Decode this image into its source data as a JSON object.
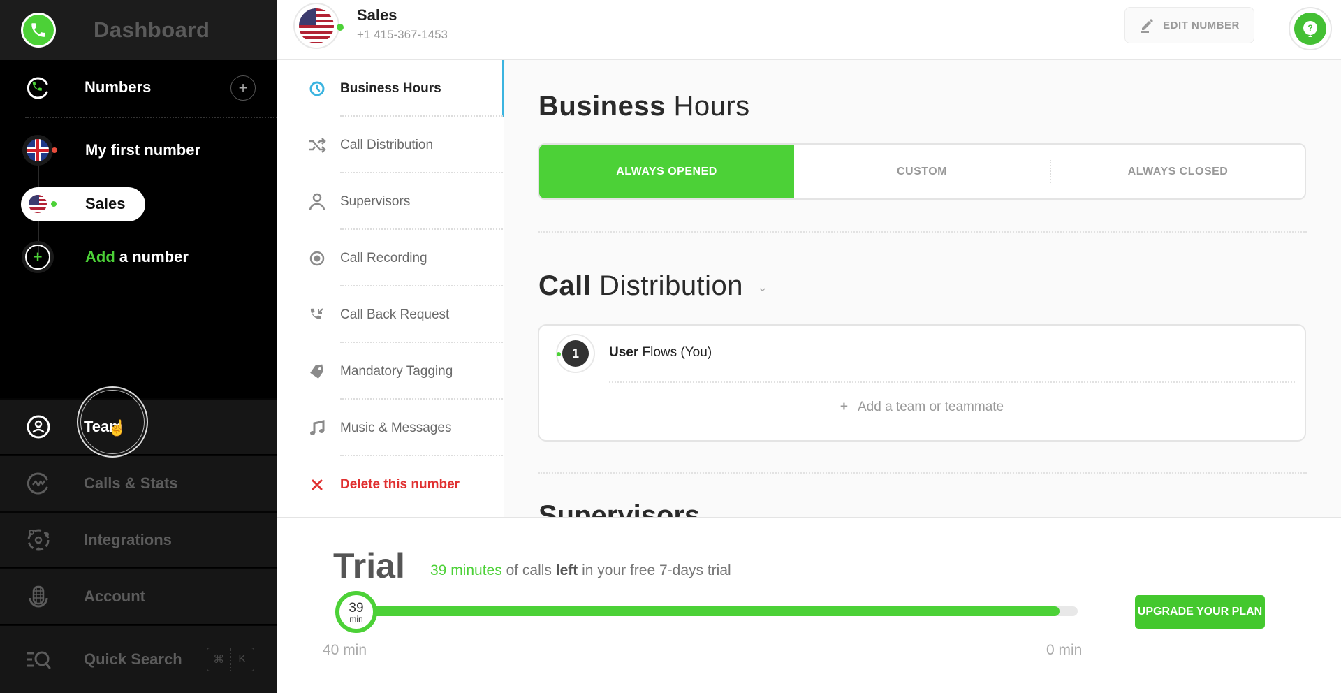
{
  "sidebar": {
    "title": "Dashboard",
    "numbers_label": "Numbers",
    "numbers": [
      {
        "label": "My first number",
        "flag": "uk-flag",
        "status_color": "#e74c3c"
      },
      {
        "label": "Sales",
        "flag": "us-flag",
        "status_color": "#4cd137",
        "active": true
      }
    ],
    "add_number": {
      "accent": "Add",
      "rest": " a number"
    },
    "nav": [
      {
        "label": "Team",
        "icon": "user-circle-icon",
        "active": true
      },
      {
        "label": "Calls & Stats",
        "icon": "stats-icon"
      },
      {
        "label": "Integrations",
        "icon": "integrations-icon"
      },
      {
        "label": "Account",
        "icon": "account-icon"
      },
      {
        "label": "Quick Search",
        "icon": "quick-search-icon"
      }
    ],
    "shortcut": {
      "mod": "⌘",
      "key": "K"
    }
  },
  "header": {
    "number_name": "Sales",
    "phone": "+1 415-367-1453",
    "edit_label": "EDIT NUMBER",
    "help_glyph": "?"
  },
  "subnav": {
    "items": [
      {
        "label": "Business Hours",
        "icon": "clock-icon",
        "active": true
      },
      {
        "label": "Call Distribution",
        "icon": "shuffle-icon"
      },
      {
        "label": "Supervisors",
        "icon": "person-icon"
      },
      {
        "label": "Call Recording",
        "icon": "record-icon"
      },
      {
        "label": "Call Back Request",
        "icon": "callback-icon"
      },
      {
        "label": "Mandatory Tagging",
        "icon": "tag-icon"
      },
      {
        "label": "Music & Messages",
        "icon": "music-icon"
      }
    ],
    "delete_label": "Delete this number"
  },
  "content": {
    "business_hours": {
      "title_bold": "Business",
      "title_light": " Hours",
      "options": [
        "ALWAYS OPENED",
        "CUSTOM",
        "ALWAYS CLOSED"
      ],
      "selected": "ALWAYS OPENED"
    },
    "call_distribution": {
      "title_bold": "Call",
      "title_light": " Distribution",
      "entries": [
        {
          "rank": "1",
          "name_bold": "User",
          "name_rest": " Flows (You)"
        }
      ],
      "add_label": "Add a team or teammate"
    },
    "next_section_title": "Supervisors"
  },
  "trial": {
    "title": "Trial",
    "msg_green": "39 minutes",
    "msg_1": " of calls ",
    "msg_bold": "left",
    "msg_2": " in your free 7-days trial",
    "remaining_minutes": 39,
    "total_minutes": 40,
    "knob_value": "39",
    "knob_unit": "min",
    "start_label": "40 min",
    "end_label": "0 min",
    "upgrade_label": "UPGRADE YOUR PLAN"
  },
  "colors": {
    "accent_green": "#4cd137",
    "active_blue": "#3bb4e0",
    "danger_red": "#e03030"
  }
}
